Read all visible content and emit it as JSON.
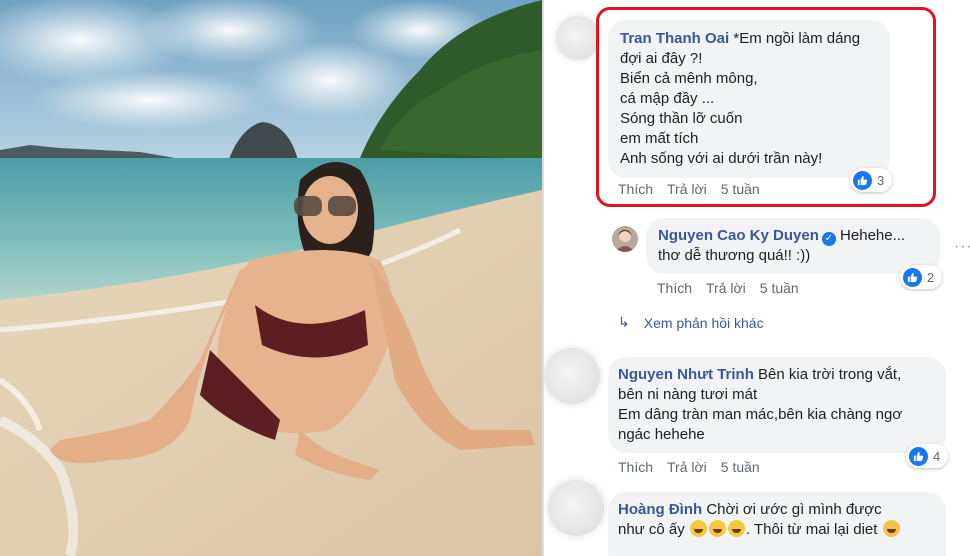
{
  "comments": [
    {
      "author": "Tran Thanh Oai",
      "lines": [
        "*Em ngồi làm dáng",
        "đợi ai đây ?!",
        "Biển cả mênh mông,",
        "cá mập đầy ...",
        "Sóng thần lỡ cuốn",
        "em mất tích",
        "Anh sống với ai dưới trần này!"
      ],
      "actions": {
        "like": "Thích",
        "reply": "Trả lời",
        "time": "5 tuần"
      },
      "reactions": "3"
    },
    {
      "author": "Nguyen Cao Ky Duyen",
      "lines": [
        "Hehehe...",
        "thơ dễ thương quá!! :))"
      ],
      "actions": {
        "like": "Thích",
        "reply": "Trả lời",
        "time": "5 tuần"
      },
      "reactions": "2"
    },
    {
      "author": "Nguyen Nhưt Trinh",
      "lines": [
        "Bên kia trời trong vắt,",
        "bên ni nàng tươi mát",
        "Em dâng tràn man mác,bên kia chàng ngơ",
        "ngác hehehe"
      ],
      "actions": {
        "like": "Thích",
        "reply": "Trả lời",
        "time": "5 tuần"
      },
      "reactions": "4"
    },
    {
      "author": "Hoàng Đình",
      "lines": [
        "Chời ơi ước gì mình được",
        "như cô ấy",
        "Thôi từ mai lại diet"
      ]
    }
  ],
  "more_replies": "Xem phản hồi khác",
  "icons": {
    "like": "thumbs-up-icon",
    "verified": "verified-badge-icon",
    "reply": "reply-arrow-icon",
    "more": "more-options-icon",
    "emoji": "grinning-emoji-icon"
  },
  "colors": {
    "highlight": "#e0141e",
    "link": "#385898",
    "bubble": "#f2f3f5",
    "like_blue": "#1877f2"
  }
}
